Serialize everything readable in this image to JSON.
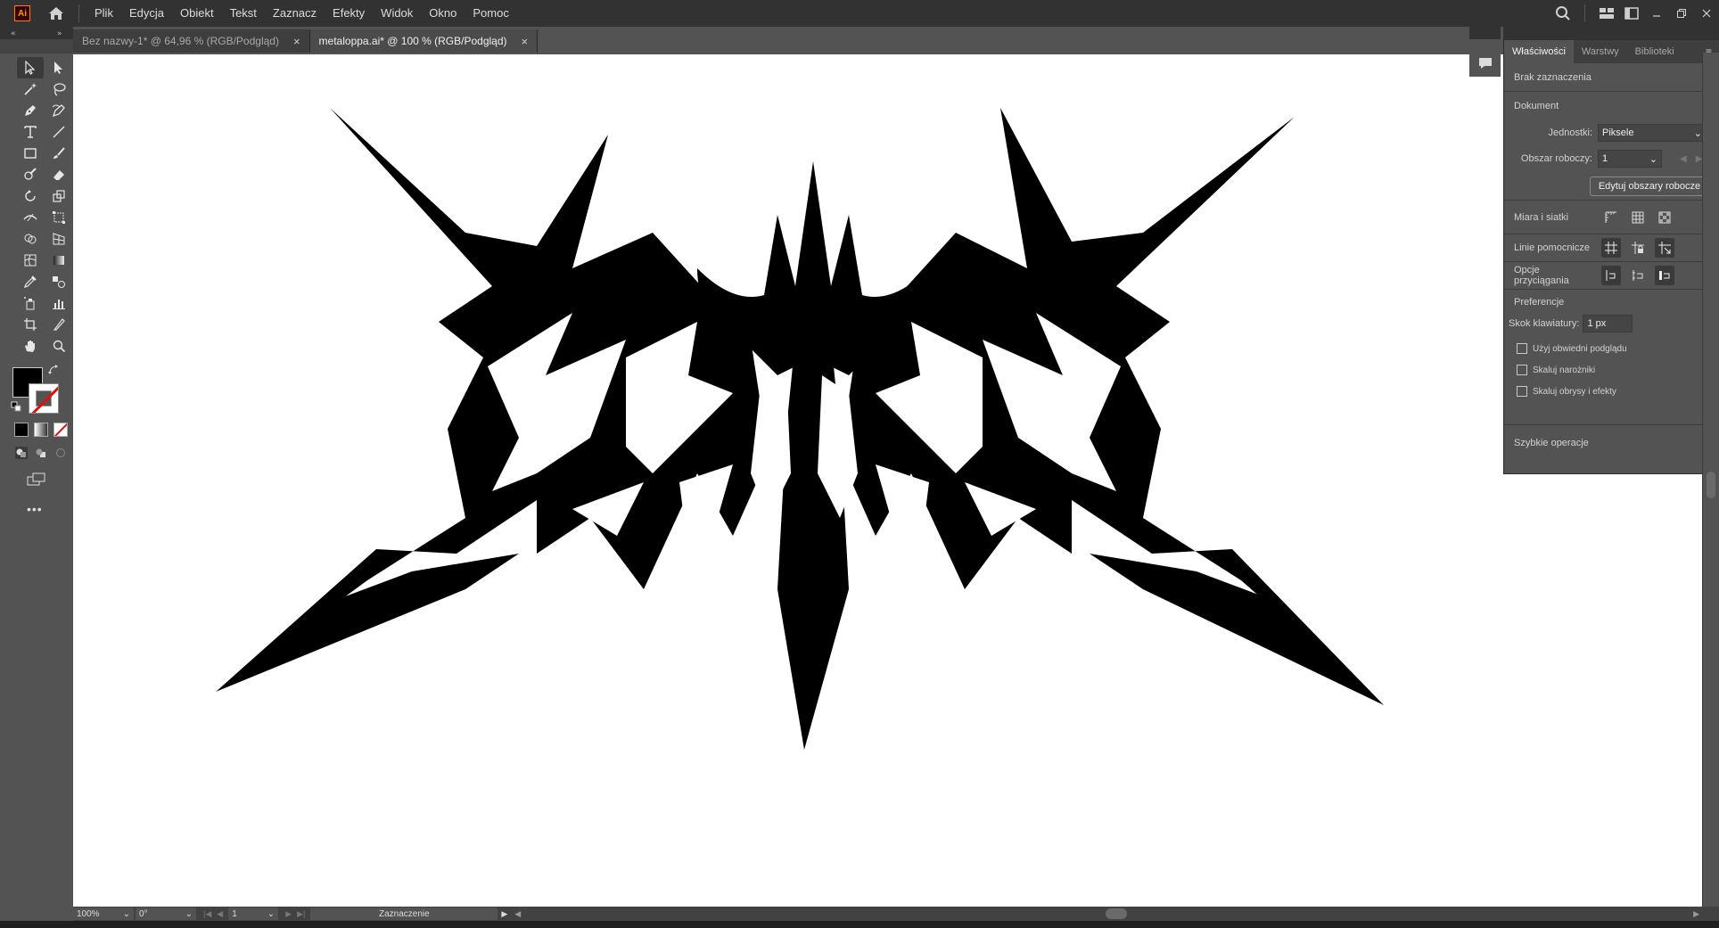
{
  "app": {
    "logo": "Ai"
  },
  "menu": {
    "items": [
      "Plik",
      "Edycja",
      "Obiekt",
      "Tekst",
      "Zaznacz",
      "Efekty",
      "Widok",
      "Okno",
      "Pomoc"
    ]
  },
  "tabs": [
    {
      "label": "Bez nazwy-1* @ 64,96 % (RGB/Podgląd)",
      "active": false
    },
    {
      "label": "metaloppa.ai* @ 100 % (RGB/Podgląd)",
      "active": true
    }
  ],
  "panel": {
    "tabs": [
      "Właściwości",
      "Warstwy",
      "Biblioteki"
    ],
    "no_selection": "Brak zaznaczenia",
    "document_title": "Dokument",
    "units_label": "Jednostki:",
    "units_value": "Piksele",
    "artboard_label": "Obszar roboczy:",
    "artboard_value": "1",
    "edit_artboards": "Edytuj obszary robocze",
    "rulers_grids": "Miara i siatki",
    "guides": "Linie pomocnicze",
    "snap_options": "Opcje przyciągania",
    "preferences": "Preferencje",
    "keyboard_increment_label": "Skok klawiatury:",
    "keyboard_increment_value": "1 px",
    "checkboxes": [
      "Użyj obwiedni podglądu",
      "Skaluj narożniki",
      "Skaluj obrysy i efekty"
    ],
    "quick_actions": "Szybkie operacje"
  },
  "status": {
    "zoom": "100%",
    "rotation": "0°",
    "artboard_num": "1",
    "tool": "Zaznaczenie"
  },
  "colors": {
    "fill": "#000000",
    "stroke": "none",
    "accent": "#ff9a00"
  }
}
